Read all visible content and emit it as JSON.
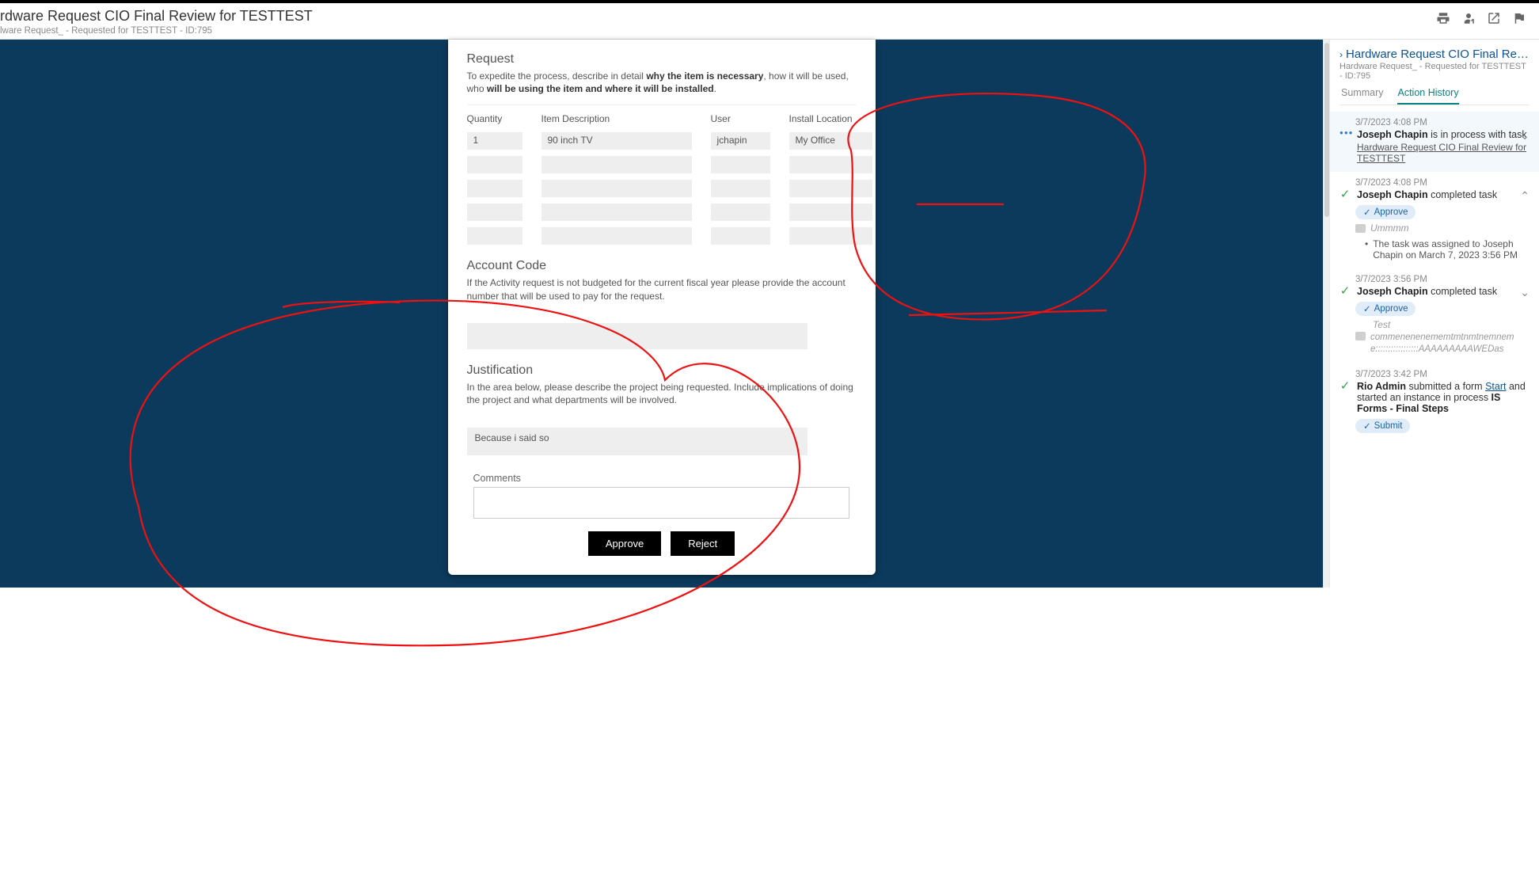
{
  "header": {
    "title": "rdware Request CIO Final Review for TESTTEST",
    "sub": "lware Request_ - Requested for TESTTEST - ID:795"
  },
  "form": {
    "request": {
      "title": "Request",
      "desc_pre": "To expedite the process, describe in detail ",
      "desc_b1": "why the item is necessary",
      "desc_mid1": ", how it will be used, who ",
      "desc_b2": "will be using the item and where it will be installed",
      "desc_end": ".",
      "columns": {
        "qty": "Quantity",
        "desc": "Item Description",
        "user": "User",
        "loc": "Install Location"
      },
      "row1": {
        "qty": "1",
        "desc": "90 inch TV",
        "user": "jchapin",
        "loc": "My Office"
      }
    },
    "account": {
      "title": "Account Code",
      "desc": "If the Activity request is not budgeted for the current fiscal year please provide the account number that will be used to pay for the request."
    },
    "justification": {
      "title": "Justification",
      "desc": "In the area below, please describe the project being requested. Include implications of doing the project and what departments will be involved.",
      "value": "Because i said so"
    },
    "comments_label": "Comments",
    "approve": "Approve",
    "reject": "Reject"
  },
  "right": {
    "title": "Hardware Request CIO Final Review for TE...",
    "sub": "Hardware Request_ - Requested for TESTTEST - ID:795",
    "tab_summary": "Summary",
    "tab_history": "Action History",
    "items": [
      {
        "time": "3/7/2023 4:08 PM",
        "who": "Joseph Chapin",
        "action": " is in process with task",
        "link": "Hardware Request CIO Final Review for TESTTEST"
      },
      {
        "time": "3/7/2023 4:08 PM",
        "who": "Joseph Chapin",
        "action": " completed task",
        "pill": "Approve",
        "comment": "Ummmm",
        "bullet": "The task was assigned to Joseph Chapin on March 7, 2023 3:56 PM"
      },
      {
        "time": "3/7/2023 3:56 PM",
        "who": "Joseph Chapin",
        "action": " completed task",
        "pill": "Approve",
        "test": "Test",
        "comment2": "commenenenememtmtnmtnemneme:::::::::::::::::AAAAAAAAAWEDas"
      },
      {
        "time": "3/7/2023 3:42 PM",
        "who": "Rio Admin",
        "action_pre": " submitted a form ",
        "start": "Start",
        "action_post": " and started an instance in process ",
        "proc": "IS Forms - Final Steps",
        "pill": "Submit"
      }
    ]
  }
}
